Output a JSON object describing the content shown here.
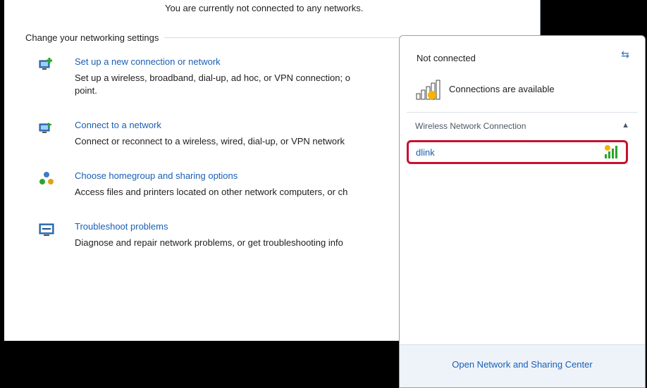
{
  "control_panel": {
    "status_text": "You are currently not connected to any networks.",
    "section_heading": "Change your networking settings",
    "tasks": [
      {
        "link": "Set up a new connection or network",
        "desc": "Set up a wireless, broadband, dial-up, ad hoc, or VPN connection; o",
        "desc2": "point."
      },
      {
        "link": "Connect to a network",
        "desc": "Connect or reconnect to a wireless, wired, dial-up, or VPN network"
      },
      {
        "link": "Choose homegroup and sharing options",
        "desc": "Access files and printers located on other network computers, or ch"
      },
      {
        "link": "Troubleshoot problems",
        "desc": "Diagnose and repair network problems, or get troubleshooting info"
      }
    ]
  },
  "flyout": {
    "title": "Not connected",
    "availability": "Connections are available",
    "group_label": "Wireless Network Connection",
    "networks": [
      {
        "name": "dlink"
      }
    ],
    "footer_link": "Open Network and Sharing Center"
  },
  "colors": {
    "link": "#1a5fb4",
    "highlight": "#c8102e"
  }
}
